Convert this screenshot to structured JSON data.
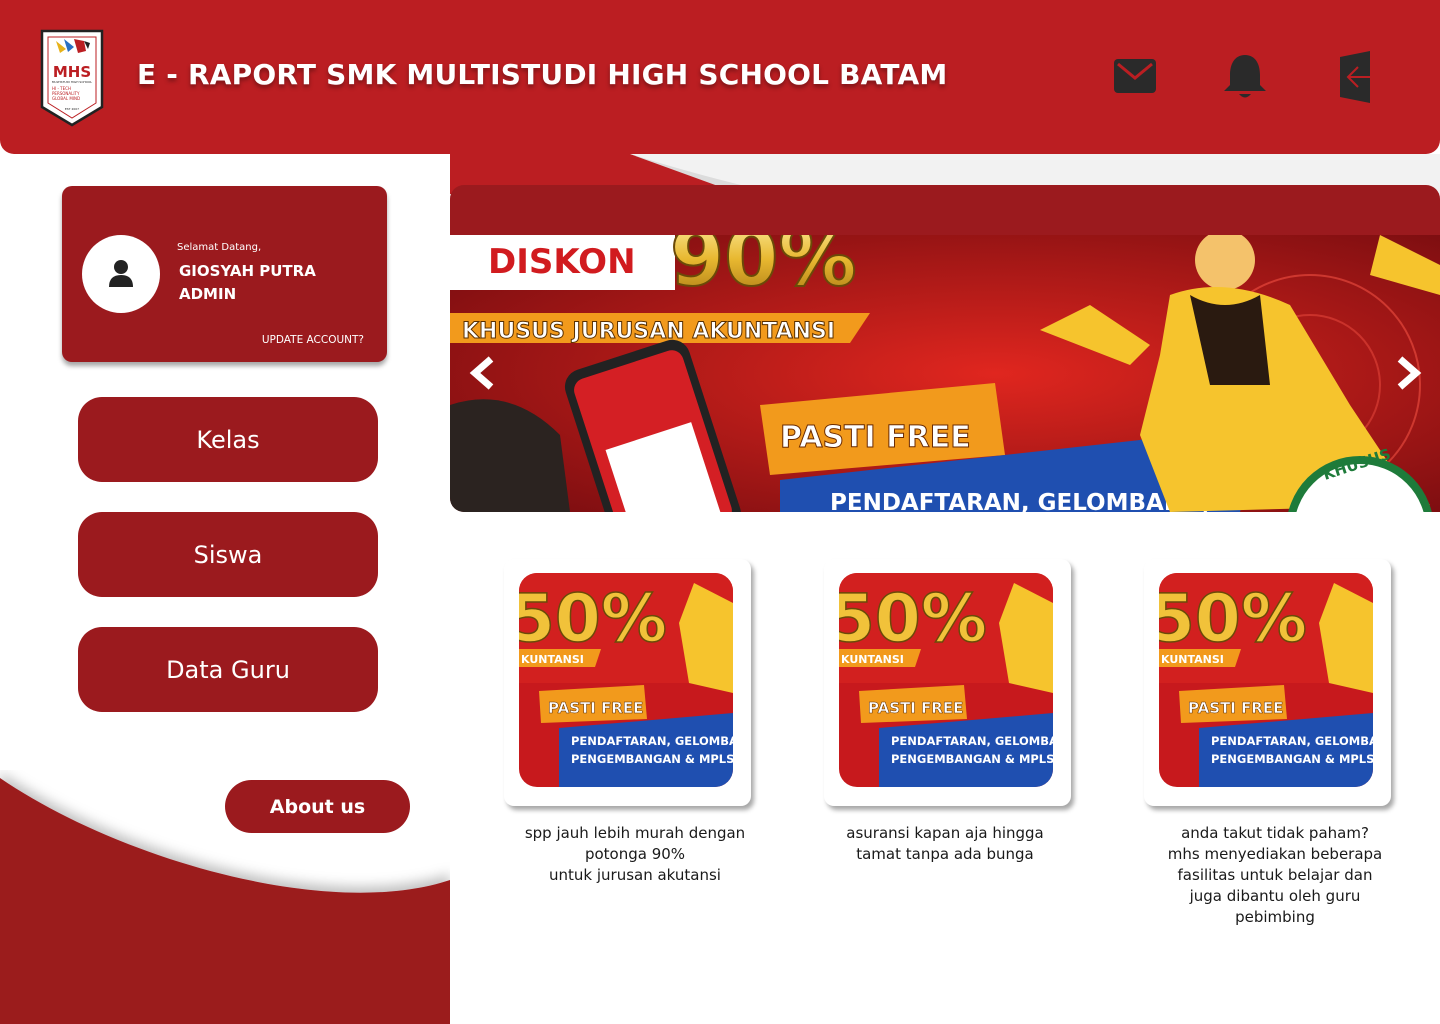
{
  "header": {
    "title": "E - RAPORT SMK MULTISTUDI HIGH SCHOOL BATAM",
    "logo": {
      "text": "MHS",
      "subtitle": "MULTISTUDI HIGH SCHOOL",
      "motto": [
        "HI - TECH",
        "PERSONALITY",
        "GLOBAL MIND"
      ],
      "est": "EST 2007"
    },
    "icons": [
      "mail-icon",
      "bell-icon",
      "logout-icon"
    ],
    "colors": {
      "primary": "#bb1e22",
      "dark": "#9b1a1e",
      "icon": "#2a2a2a"
    }
  },
  "profile": {
    "greeting": "Selamat Datang,",
    "name": "GIOSYAH PUTRA",
    "role": "ADMIN",
    "update_link": "UPDATE ACCOUNT?"
  },
  "nav": {
    "items": [
      {
        "label": "Kelas"
      },
      {
        "label": "Siswa"
      },
      {
        "label": "Data Guru"
      }
    ],
    "about": "About us"
  },
  "banner": {
    "diskon": "DISKON",
    "percent": "90%",
    "subtitle": "KHUSUS JURUSAN AKUNTANSI",
    "free": "PASTI FREE",
    "bottom": "PENDAFTARAN, GELOMBANG,",
    "badge": "KHUSUS"
  },
  "cards": [
    {
      "percent": "50%",
      "tag": "KUNTANSI",
      "free": "PASTI FREE",
      "line1": "PENDAFTARAN, GELOMBA",
      "line2": "PENGEMBANGAN & MPLS",
      "caption": "spp jauh lebih murah  dengan\npotonga 90%\nuntuk jurusan akutansi"
    },
    {
      "percent": "50%",
      "tag": "KUNTANSI",
      "free": "PASTI FREE",
      "line1": "PENDAFTARAN, GELOMBA",
      "line2": "PENGEMBANGAN & MPLS",
      "caption": "asuransi kapan aja hingga\ntamat tanpa ada bunga"
    },
    {
      "percent": "50%",
      "tag": "KUNTANSI",
      "free": "PASTI FREE",
      "line1": "PENDAFTARAN, GELOMBA",
      "line2": "PENGEMBANGAN & MPLS",
      "caption": "anda takut tidak paham?\nmhs menyediakan beberapa\nfasilitas untuk belajar dan\njuga dibantu oleh guru\npebimbing"
    }
  ]
}
